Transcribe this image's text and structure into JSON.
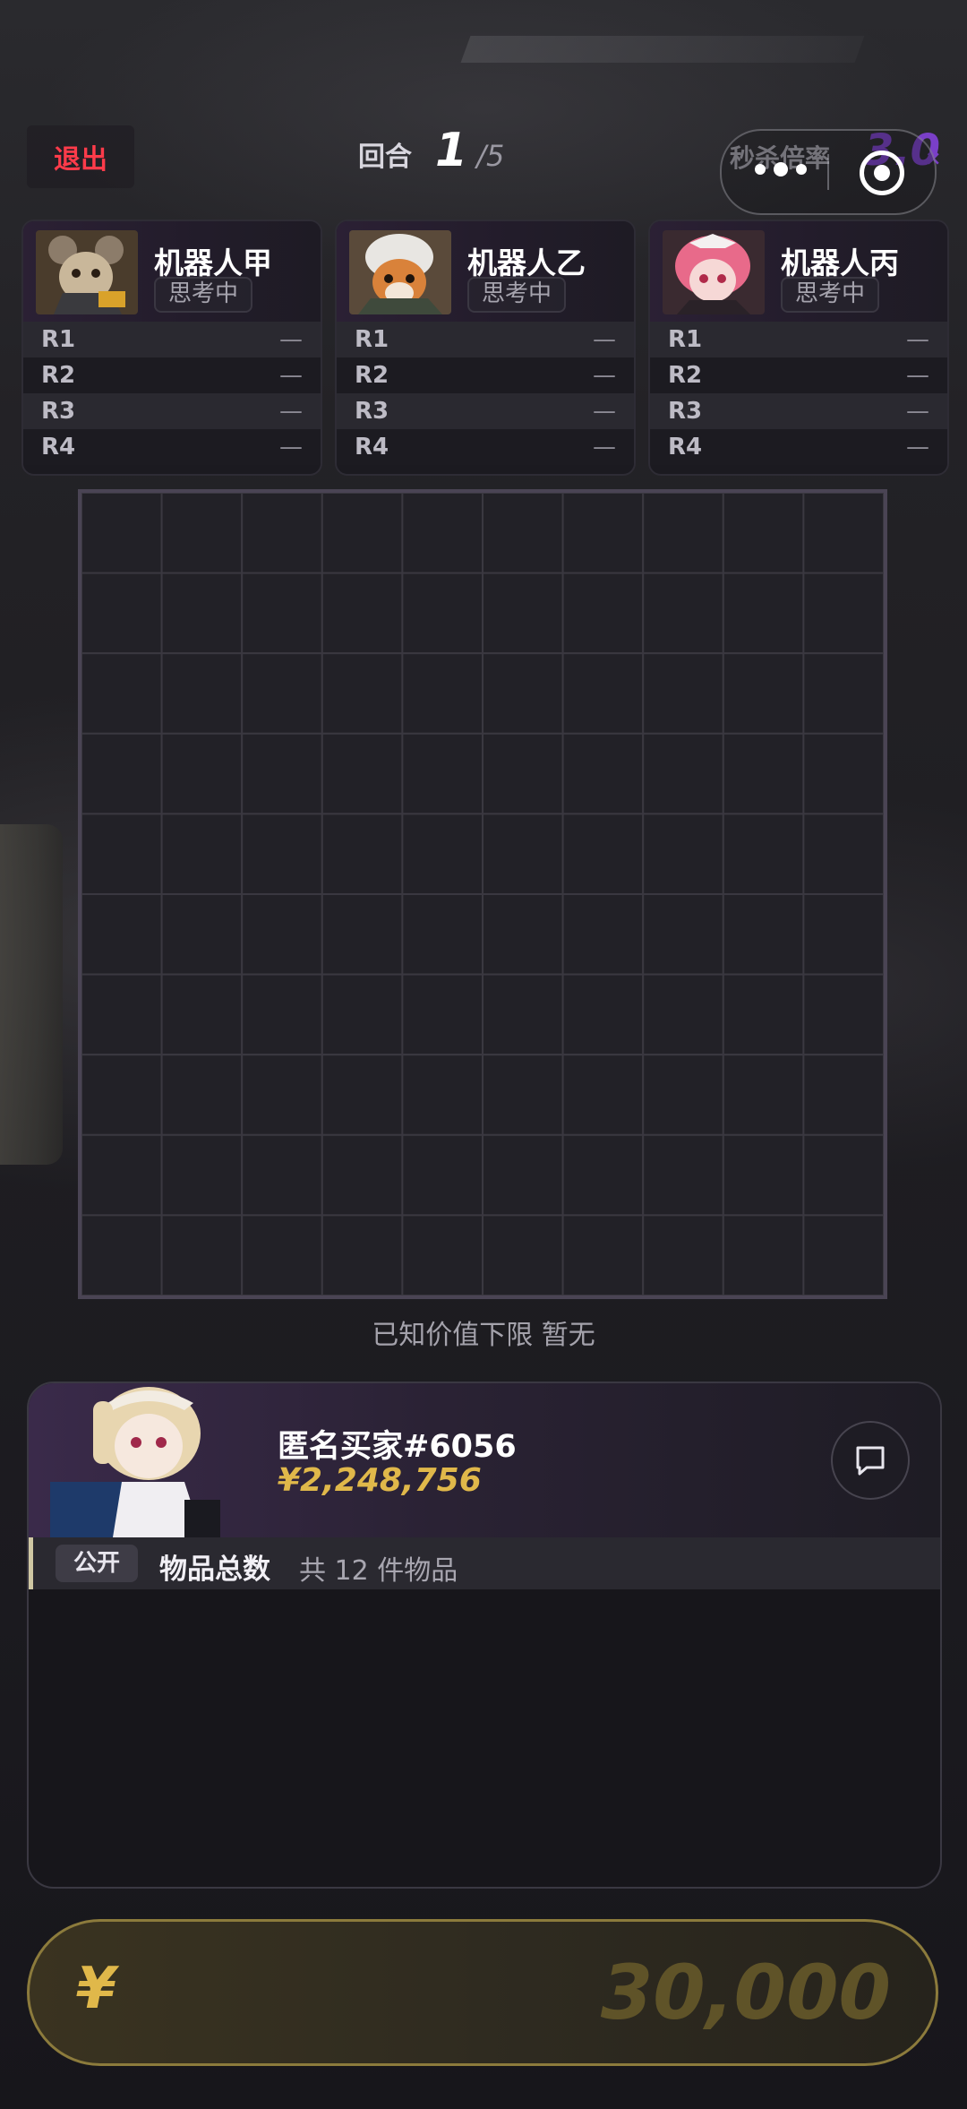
{
  "top": {
    "exit_label": "退出",
    "round_label": "回合",
    "round_current": "1",
    "round_total": "/5",
    "kill_label": "秒杀倍率",
    "kill_value": "3.0",
    "kill_suffix": "×"
  },
  "bots": [
    {
      "name": "机器人甲",
      "status": "思考中",
      "avatar": "mouse-robot-avatar",
      "rounds": [
        {
          "label": "R1",
          "value": "—"
        },
        {
          "label": "R2",
          "value": "—"
        },
        {
          "label": "R3",
          "value": "—"
        },
        {
          "label": "R4",
          "value": "—"
        }
      ]
    },
    {
      "name": "机器人乙",
      "status": "思考中",
      "avatar": "fox-pilot-avatar",
      "rounds": [
        {
          "label": "R1",
          "value": "—"
        },
        {
          "label": "R2",
          "value": "—"
        },
        {
          "label": "R3",
          "value": "—"
        },
        {
          "label": "R4",
          "value": "—"
        }
      ]
    },
    {
      "name": "机器人丙",
      "status": "思考中",
      "avatar": "pink-maid-avatar",
      "rounds": [
        {
          "label": "R1",
          "value": "—"
        },
        {
          "label": "R2",
          "value": "—"
        },
        {
          "label": "R3",
          "value": "—"
        },
        {
          "label": "R4",
          "value": "—"
        }
      ]
    }
  ],
  "grid": {
    "rows": 10,
    "cols": 10
  },
  "known_value": "已知价值下限 暂无",
  "buyer": {
    "name": "匿名买家#6056",
    "money": "¥2,248,756",
    "avatar": "bunny-girl-avatar"
  },
  "items": {
    "tag": "公开",
    "title": "物品总数",
    "count": "共 12 件物品"
  },
  "bid": {
    "currency": "¥",
    "placeholder": "30,000"
  },
  "colors": {
    "exit": "#ff3b4a",
    "accent_purple": "#7a3fc8",
    "gold": "#e0b84a"
  }
}
